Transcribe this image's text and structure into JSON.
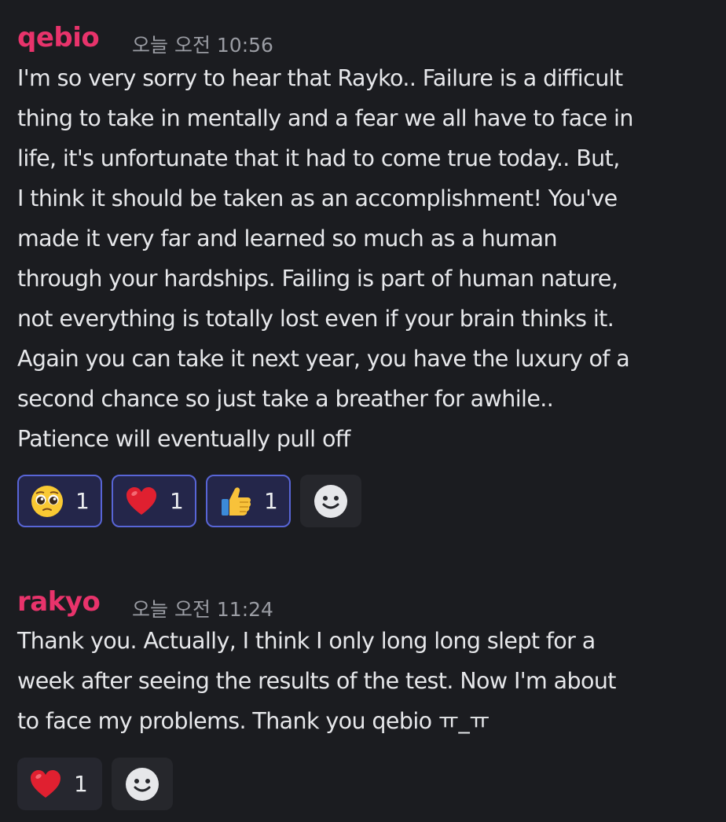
{
  "messages": [
    {
      "username": "qebio",
      "timestamp": "오늘 오전 10:56",
      "text": "I'm so very sorry to hear that Rayko.. Failure is a difficult\nthing to take in mentally and a fear we all have to face in\nlife, it's unfortunate that it had to come true today.. But,\nI think it should be taken as an accomplishment! You've\nmade it very far and learned so much as a human\nthrough your hardships. Failing is part of human nature,\nnot everything is totally lost even if your brain thinks it.\nAgain you can take it next year, you have the luxury of a\nsecond chance so just take a breather for awhile..\nPatience will eventually pull off",
      "reactions": [
        {
          "icon": "pleading-face-emoji",
          "count": "1"
        },
        {
          "icon": "red-heart-emoji",
          "count": "1"
        },
        {
          "icon": "thumbs-up-emoji",
          "count": "1"
        }
      ]
    },
    {
      "username": "rakyo",
      "timestamp": "오늘 오전 11:24",
      "text": "Thank you. Actually, I think I only long long slept for a\nweek after seeing the results of the test. Now I'm about\nto face my problems. Thank you qebio ㅠ_ㅠ",
      "reactions": [
        {
          "icon": "red-heart-emoji",
          "count": "1"
        }
      ]
    }
  ],
  "colors": {
    "background": "#1b1c20",
    "username": "#e8336b",
    "timestamp": "#9a9ca3",
    "reaction_selected_border": "#5865d6"
  },
  "add_reaction_icon": "smiley-add-reaction-icon"
}
